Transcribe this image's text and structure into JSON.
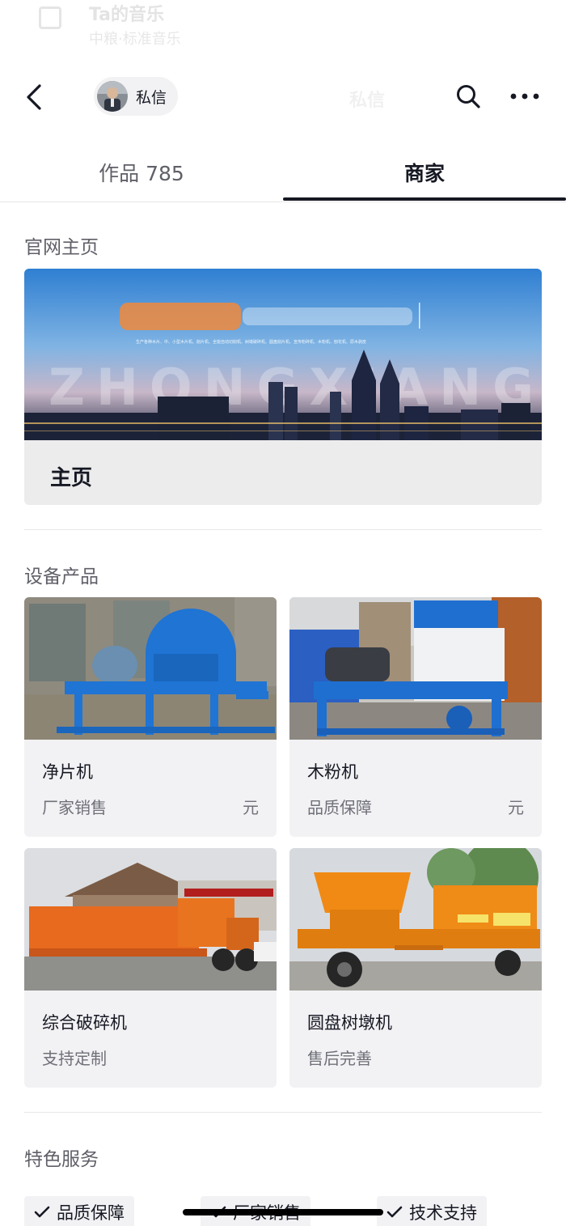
{
  "faded_header": {
    "title": "Ta的音乐",
    "subtitle": "中粮·标准音乐"
  },
  "navbar": {
    "back_icon": "chevron-left-icon",
    "dm_label": "私信",
    "ghost_title": "私信",
    "search_icon": "search-icon",
    "more_icon": "more-dots-icon"
  },
  "tabs": [
    {
      "label": "作品 785",
      "active": false
    },
    {
      "label": "商家",
      "active": true
    }
  ],
  "website": {
    "section_title": "官网主页",
    "banner_watermark": "ZHONGXIANG",
    "banner_caption": "生产各种木片、中、小型木片机、削片机、全能自动切削机、树墩破碎机、圆盘削片机、宣传粉碎机、木粉机、刨花机、原木剥皮",
    "link_label": "主页"
  },
  "products": {
    "section_title": "设备产品",
    "items": [
      {
        "name": "净片机",
        "tag": "厂家销售",
        "price": "元",
        "image": "blue-drum-chipper-photo"
      },
      {
        "name": "木粉机",
        "tag": "品质保障",
        "price": "元",
        "image": "blue-white-wood-flour-mill-photo"
      },
      {
        "name": "综合破碎机",
        "tag": "支持定制",
        "price": "",
        "image": "orange-comprehensive-crusher-photo"
      },
      {
        "name": "圆盘树墩机",
        "tag": "售后完善",
        "price": "",
        "image": "orange-disc-stump-grinder-photo"
      }
    ]
  },
  "services": {
    "section_title": "特色服务",
    "chips": [
      "品质保障",
      "厂家销售",
      "技术支持"
    ]
  },
  "colors": {
    "text_primary": "#161823",
    "text_secondary": "#5f6068",
    "card_bg": "#f2f2f4",
    "blue_machine": "#1f74d4",
    "orange_machine": "#e8741f"
  }
}
